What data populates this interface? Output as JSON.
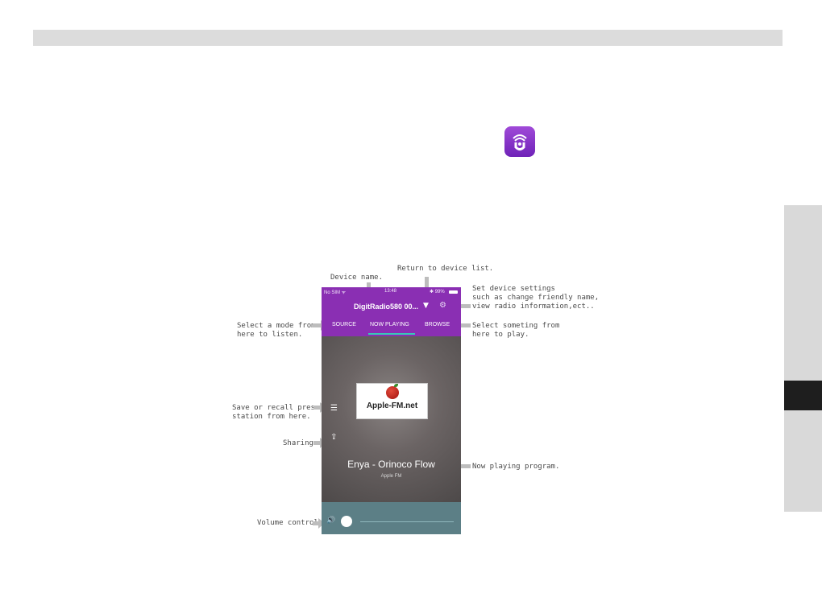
{
  "annotations": {
    "device_name": "Device name.",
    "return_device_list": "Return to device list.",
    "settings_line1": "Set device settings",
    "settings_line2": "such as change friendly name,",
    "settings_line3": "view radio information,ect..",
    "select_mode_line1": "Select a mode from",
    "select_mode_line2": "here to listen.",
    "select_browse_line1": "Select someting from",
    "select_browse_line2": "here to play.",
    "preset_line1": "Save or recall preset",
    "preset_line2": "station from here.",
    "sharing": "Sharing",
    "now_playing_program": "Now playing program.",
    "volume_control": "Volume control"
  },
  "phone": {
    "status_left": "No SIM ᯤ",
    "status_time": "13:48",
    "status_right": "✱ 99%",
    "device_name": "DigitRadio580 00...",
    "tabs": {
      "source": "SOURCE",
      "now_playing": "NOW PLAYING",
      "browse": "BROWSE"
    },
    "logo_text": "Apple-FM.net",
    "track_title": "Enya - Orinoco Flow",
    "station": "Apple FM"
  },
  "icons": {
    "app": "undok-app-icon",
    "caret": "chevron-down-icon",
    "settings": "gear-icon",
    "list": "list-icon",
    "share": "share-icon",
    "volume": "speaker-icon"
  },
  "colors": {
    "header": "#8a2fb3",
    "accent": "#38c8b6",
    "volume_bar": "#5c7f86",
    "side_tab_active": "#1e1e1e"
  }
}
